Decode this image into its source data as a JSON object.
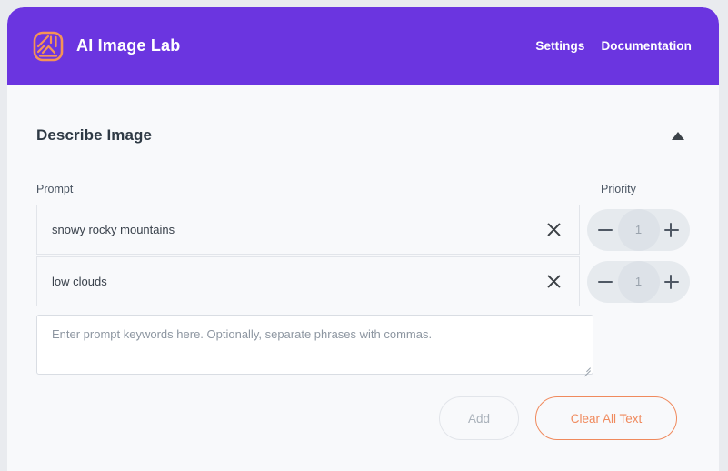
{
  "header": {
    "logo_icon": "mountain-lines-logo-icon",
    "brand_title": "AI Image Lab",
    "nav": [
      {
        "label": "Settings",
        "name": "settings"
      },
      {
        "label": "Documentation",
        "name": "documentation"
      }
    ],
    "background_color": "#6b35e0"
  },
  "panel": {
    "title": "Describe Image",
    "collapse_icon": "caret-up-icon",
    "columns": {
      "prompt_label": "Prompt",
      "priority_label": "Priority"
    },
    "rows": [
      {
        "prompt": "snowy rocky mountains",
        "priority": "1",
        "remove_icon": "close-x-icon",
        "decrement_label": "−",
        "increment_label": "+"
      },
      {
        "prompt": "low clouds",
        "priority": "1",
        "remove_icon": "close-x-icon",
        "decrement_label": "−",
        "increment_label": "+"
      }
    ],
    "new_prompt": {
      "value": "",
      "placeholder": "Enter prompt keywords here. Optionally, separate phrases with commas."
    },
    "actions": {
      "add_label": "Add",
      "add_disabled": true,
      "clear_label": "Clear All Text",
      "clear_color": "#f08a5d"
    }
  },
  "theme": {
    "accent_purple": "#6b35e0",
    "accent_orange": "#f08a5d",
    "page_background": "#e9ebef",
    "card_background": "#f8f9fb"
  }
}
